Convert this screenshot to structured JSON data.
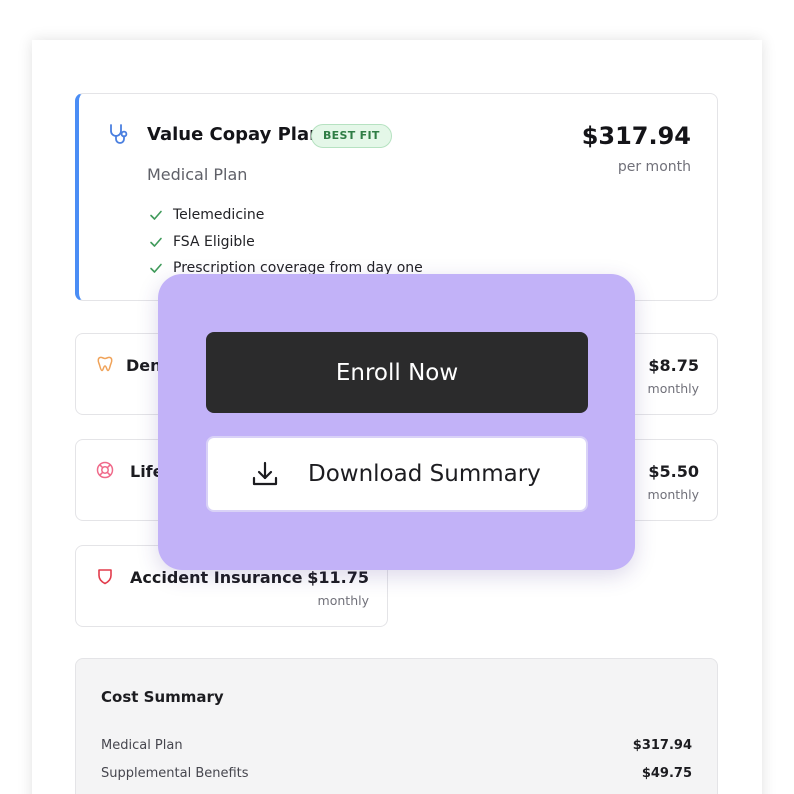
{
  "medical_plan": {
    "title": "Value Copay Plan",
    "badge": "BEST FIT",
    "subtitle": "Medical Plan",
    "price": "$317.94",
    "price_unit": "per month",
    "features": [
      "Telemedicine",
      "FSA Eligible",
      "Prescription coverage from day one"
    ],
    "icon": "stethoscope-icon",
    "accent_color": "#4a8df5"
  },
  "benefits": [
    {
      "name": "Den",
      "price": "$8.75",
      "unit": "monthly",
      "icon": "tooth-icon",
      "icon_color": "#f0a35a"
    },
    {
      "name": "Life",
      "price": "$5.50",
      "unit": "monthly",
      "icon": "lifebuoy-icon",
      "icon_color": "#f06a8a"
    },
    {
      "name": "Accident Insurance",
      "price": "$11.75",
      "unit": "monthly",
      "icon": "shield-icon",
      "icon_color": "#e23c4c"
    }
  ],
  "summary": {
    "title": "Cost Summary",
    "rows": [
      {
        "label": "Medical Plan",
        "amount": "$317.94"
      },
      {
        "label": "Supplemental Benefits",
        "amount": "$49.75"
      }
    ]
  },
  "actions": {
    "enroll_label": "Enroll Now",
    "download_label": "Download Summary",
    "overlay_color": "#c2b2f8",
    "enroll_color": "#2b2b2c"
  }
}
